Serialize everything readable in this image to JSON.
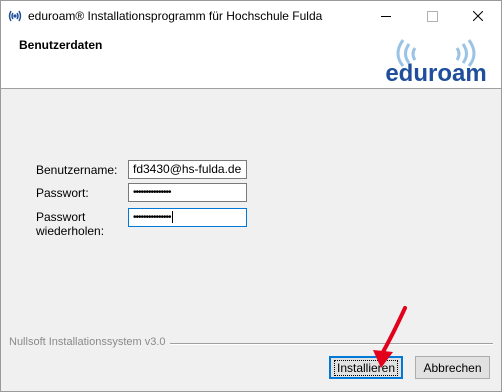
{
  "window": {
    "title": "eduroam® Installationsprogramm für Hochschule Fulda"
  },
  "header": {
    "title": "Benutzerdaten",
    "logo_text": "eduroam"
  },
  "form": {
    "username": {
      "label": "Benutzername:",
      "value": "fd3430@hs-fulda.de"
    },
    "password": {
      "label": "Passwort:",
      "masked_value": "•••••••••••••••"
    },
    "password_repeat": {
      "label_line1": "Passwort",
      "label_line2": "wiederholen:",
      "masked_value": "•••••••••••••••"
    }
  },
  "footer": {
    "branding": "Nullsoft Installationssystem v3.0"
  },
  "buttons": {
    "install": "Installieren",
    "cancel": "Abbrechen"
  },
  "colors": {
    "accent": "#0078d7",
    "logo_blue": "#1f4f9c",
    "logo_lightblue": "#9bc3e6",
    "arrow": "#e3001b"
  }
}
